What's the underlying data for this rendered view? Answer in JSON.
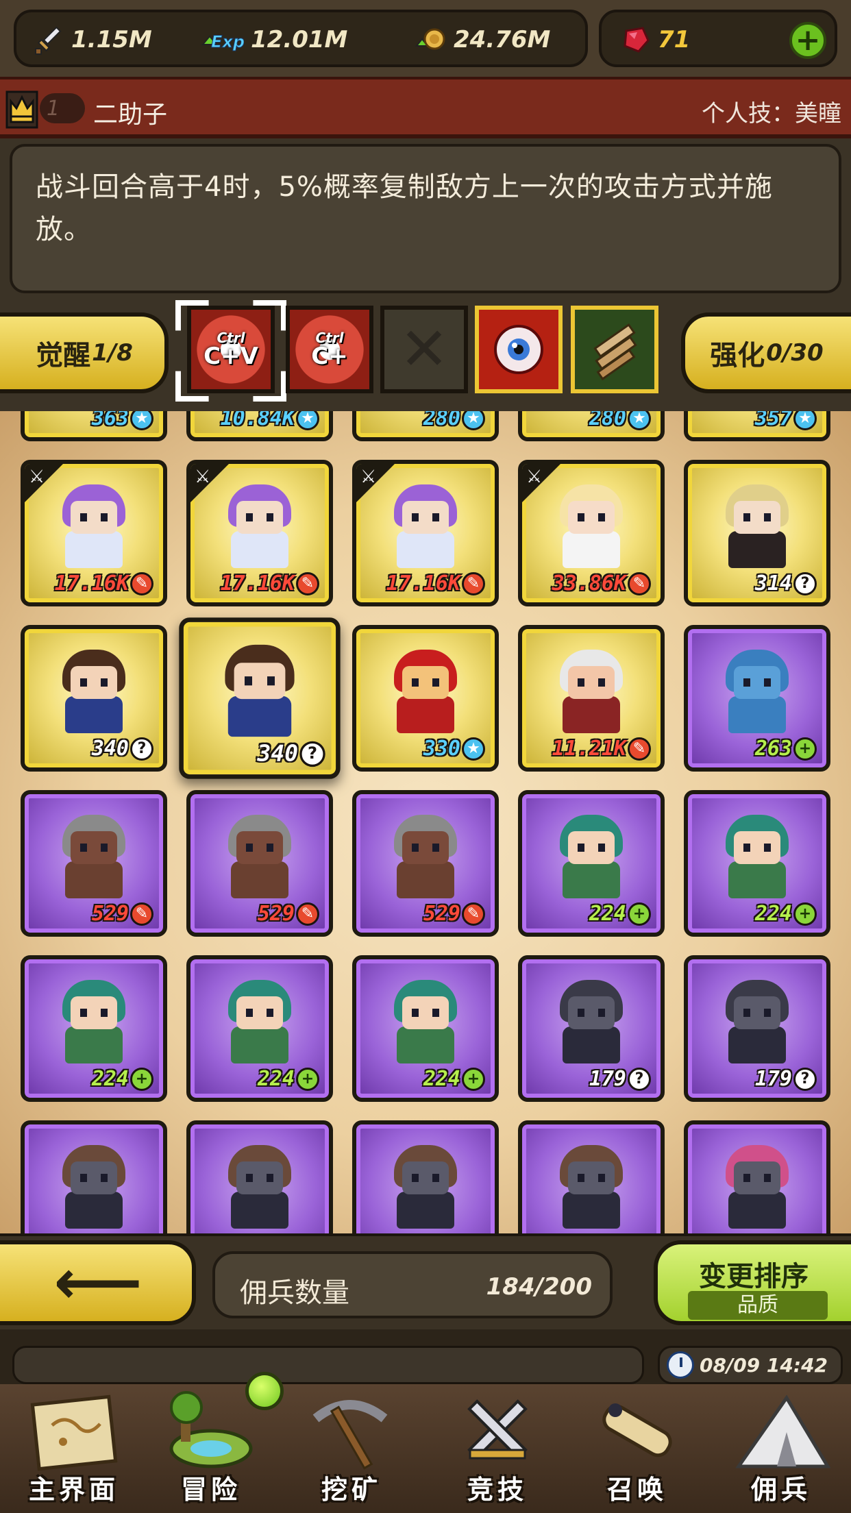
{
  "resources": {
    "attack": "1.15M",
    "exp": "12.01M",
    "gold": "24.76M",
    "gems": "71"
  },
  "skill_header": {
    "rank": "1",
    "hero_name": "二助子",
    "personal_skill": "个人技：美瞳"
  },
  "description": "战斗回合高于4时，5%概率复制敌方上一次的攻击方式并施放。",
  "awaken": {
    "awaken_label": "觉醒",
    "awaken_value": "1/8",
    "enhance_label": "强化",
    "enhance_value": "0/30",
    "slots": [
      {
        "kind": "ctrl",
        "top": "Ctrl",
        "main": "C+V"
      },
      {
        "kind": "ctrl",
        "top": "Ctrl",
        "main": "C+"
      },
      {
        "kind": "empty",
        "glyph": "✕"
      },
      {
        "kind": "eye"
      },
      {
        "kind": "scroll"
      }
    ]
  },
  "heroes": [
    {
      "frame": "gold",
      "power": "363",
      "badge": "blue",
      "hair": "#4a3a30",
      "skin": "#c98f6a",
      "body": "#333333"
    },
    {
      "frame": "gold",
      "power": "10.84K",
      "badge": "blue",
      "hair": "#5a5a5a",
      "skin": "#7a7a7a",
      "body": "#4a4a4a"
    },
    {
      "frame": "gold",
      "power": "280",
      "badge": "blue",
      "hair": "#5a5a5a",
      "skin": "#7a7a7a",
      "body": "#4a4a4a"
    },
    {
      "frame": "gold",
      "power": "280",
      "badge": "blue",
      "hair": "#5a5a5a",
      "skin": "#7a7a7a",
      "body": "#4a4a4a"
    },
    {
      "frame": "gold",
      "power": "357",
      "badge": "blue",
      "hair": "#6a6a6a",
      "skin": "#8a8a8a",
      "body": "#5a5a5a"
    },
    {
      "frame": "gold",
      "power": "17.16K",
      "badge": "red",
      "sword": true,
      "hair": "#9b62d6",
      "skin": "#f3dcc8",
      "body": "#dfe6f8"
    },
    {
      "frame": "gold",
      "power": "17.16K",
      "badge": "red",
      "sword": true,
      "hair": "#9b62d6",
      "skin": "#f3dcc8",
      "body": "#dfe6f8"
    },
    {
      "frame": "gold",
      "power": "17.16K",
      "badge": "red",
      "sword": true,
      "hair": "#9b62d6",
      "skin": "#f3dcc8",
      "body": "#dfe6f8"
    },
    {
      "frame": "gold",
      "power": "33.86K",
      "badge": "red",
      "sword": true,
      "hair": "#f6e3a6",
      "skin": "#f6dcc8",
      "body": "#f4f4f4"
    },
    {
      "frame": "gold",
      "power": "314",
      "badge": "white",
      "hair": "#e0cf8a",
      "skin": "#f3dcc8",
      "body": "#2a2222"
    },
    {
      "frame": "gold",
      "power": "340",
      "badge": "white",
      "hair": "#4a2d1c",
      "skin": "#f3d3b8",
      "body": "#2a3d8a"
    },
    {
      "frame": "gold",
      "power": "340",
      "badge": "white",
      "hair": "#4a2d1c",
      "skin": "#f3d3b8",
      "body": "#2a3d8a",
      "selected": true
    },
    {
      "frame": "gold",
      "power": "330",
      "badge": "blue",
      "hair": "#c81e1e",
      "skin": "#f3c27a",
      "body": "#b81e1e"
    },
    {
      "frame": "gold",
      "power": "11.21K",
      "badge": "red",
      "hair": "#e8e8e8",
      "skin": "#f3c6a8",
      "body": "#8a2424"
    },
    {
      "frame": "purple",
      "power": "263",
      "badge": "green",
      "hair": "#3a7fbf",
      "skin": "#5aa0d8",
      "body": "#3a7fbf"
    },
    {
      "frame": "purple",
      "power": "529",
      "badge": "red",
      "hair": "#8a8a8a",
      "skin": "#7a4a3a",
      "body": "#6a4030"
    },
    {
      "frame": "purple",
      "power": "529",
      "badge": "red",
      "hair": "#8a8a8a",
      "skin": "#7a4a3a",
      "body": "#6a4030"
    },
    {
      "frame": "purple",
      "power": "529",
      "badge": "red",
      "hair": "#8a8a8a",
      "skin": "#7a4a3a",
      "body": "#6a4030"
    },
    {
      "frame": "purple",
      "power": "224",
      "badge": "green",
      "hair": "#2a8a7a",
      "skin": "#f3d3b8",
      "body": "#3a7a4a"
    },
    {
      "frame": "purple",
      "power": "224",
      "badge": "green",
      "hair": "#2a8a7a",
      "skin": "#f3d3b8",
      "body": "#3a7a4a"
    },
    {
      "frame": "purple",
      "power": "224",
      "badge": "green",
      "hair": "#2a8a7a",
      "skin": "#f3d3b8",
      "body": "#3a7a4a"
    },
    {
      "frame": "purple",
      "power": "224",
      "badge": "green",
      "hair": "#2a8a7a",
      "skin": "#f3d3b8",
      "body": "#3a7a4a"
    },
    {
      "frame": "purple",
      "power": "224",
      "badge": "green",
      "hair": "#2a8a7a",
      "skin": "#f3d3b8",
      "body": "#3a7a4a"
    },
    {
      "frame": "purple",
      "power": "179",
      "badge": "white",
      "hair": "#3a3a48",
      "skin": "#5a5a6a",
      "body": "#2a2a3a"
    },
    {
      "frame": "purple",
      "power": "179",
      "badge": "white",
      "hair": "#3a3a48",
      "skin": "#5a5a6a",
      "body": "#2a2a3a"
    },
    {
      "frame": "purple",
      "power": "",
      "badge": "",
      "hair": "#6a4a3a",
      "skin": "#5a5a6a",
      "body": "#2a2a3a"
    },
    {
      "frame": "purple",
      "power": "",
      "badge": "",
      "hair": "#6a4a3a",
      "skin": "#5a5a6a",
      "body": "#2a2a3a"
    },
    {
      "frame": "purple",
      "power": "",
      "badge": "",
      "hair": "#6a4a3a",
      "skin": "#5a5a6a",
      "body": "#2a2a3a"
    },
    {
      "frame": "purple",
      "power": "",
      "badge": "",
      "hair": "#6a4a3a",
      "skin": "#5a5a6a",
      "body": "#2a2a3a"
    },
    {
      "frame": "purple",
      "power": "",
      "badge": "",
      "hair": "#d0508a",
      "skin": "#5a5a6a",
      "body": "#2a2a3a"
    }
  ],
  "bottom": {
    "count_label": "佣兵数量",
    "count_value": "184/200",
    "sort_title": "变更排序",
    "sort_sub": "品质"
  },
  "status": {
    "time": "08/09 14:42"
  },
  "nav": [
    {
      "label": "主界面",
      "icon": "map-icon"
    },
    {
      "label": "冒险",
      "icon": "island-icon"
    },
    {
      "label": "挖矿",
      "icon": "pickaxe-icon"
    },
    {
      "label": "竞技",
      "icon": "swords-icon"
    },
    {
      "label": "召唤",
      "icon": "scroll-icon"
    },
    {
      "label": "佣兵",
      "icon": "tent-icon"
    }
  ],
  "colors": {
    "gold_button": "#e8c93a",
    "green_button": "#b6e04a",
    "header_red": "#7a2a1c",
    "panel_dark": "#3b3326"
  }
}
